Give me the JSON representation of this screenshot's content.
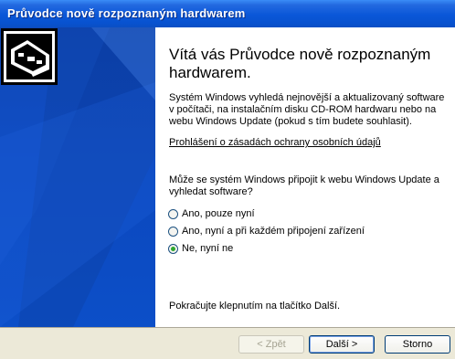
{
  "window": {
    "title": "Průvodce nově rozpoznaným hardwarem"
  },
  "wizard": {
    "heading": "Vítá vás Průvodce nově rozpoznaným hardwarem.",
    "description": "Systém Windows vyhledá nejnovější a aktualizovaný software v počítači, na instalačním disku CD-ROM hardwaru nebo na webu Windows Update (pokud s tím budete souhlasit).",
    "privacy_link": "Prohlášení o zásadách ochrany osobních údajů",
    "question": "Může se systém Windows připojit k webu Windows Update a vyhledat software?",
    "options": [
      {
        "label": "Ano, pouze nyní",
        "checked": false
      },
      {
        "label": "Ano, nyní a při každém připojení zařízení",
        "checked": false
      },
      {
        "label": "Ne, nyní ne",
        "checked": true
      }
    ],
    "continue_text": "Pokračujte klepnutím na tlačítko Další."
  },
  "buttons": {
    "back": "< Zpět",
    "next": "Další >",
    "cancel": "Storno"
  },
  "colors": {
    "titlebar": "#0a57d8",
    "left_panel": "#0b47bd",
    "button_bar": "#ece9d8",
    "radio_check": "#30a830"
  },
  "icons": {
    "wizard_graphic": "hardware-card-icon"
  }
}
